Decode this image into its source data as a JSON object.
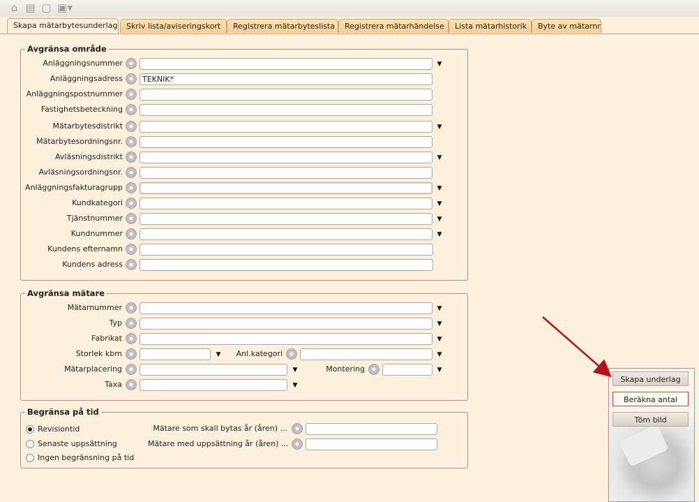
{
  "toolbar": {
    "icons": [
      "open-icon",
      "print-icon",
      "print-preview-icon",
      "export-menu-icon"
    ]
  },
  "tabs": [
    {
      "label": "Skapa mätarbytesunderlag",
      "active": true
    },
    {
      "label": "Skriv lista/aviseringskort",
      "active": false
    },
    {
      "label": "Registrera mätarbyteslista",
      "active": false
    },
    {
      "label": "Registrera mätarhändelse",
      "active": false
    },
    {
      "label": "Lista mätarhistorik",
      "active": false
    },
    {
      "label": "Byte av mätarnr",
      "active": false
    }
  ],
  "area": {
    "legend": "Avgränsa område",
    "fields": [
      {
        "label": "Anläggningsnummer",
        "value": "",
        "dropdown": true
      },
      {
        "label": "Anläggningsadress",
        "value": "TEKNIK*",
        "dropdown": false
      },
      {
        "label": "Anläggningspostnummer",
        "value": "",
        "dropdown": false
      },
      {
        "label": "Fastighetsbeteckning",
        "value": "",
        "dropdown": false
      },
      {
        "label": "Mätarbytesdistrikt",
        "value": "",
        "dropdown": true
      },
      {
        "label": "Mätarbytesordningsnr.",
        "value": "",
        "dropdown": false
      },
      {
        "label": "Avläsningsdistrikt",
        "value": "",
        "dropdown": true
      },
      {
        "label": "Avläsningsordningsnr.",
        "value": "",
        "dropdown": false
      },
      {
        "label": "Anläggningsfakturagrupp",
        "value": "",
        "dropdown": true
      },
      {
        "label": "Kundkategori",
        "value": "",
        "dropdown": true
      },
      {
        "label": "Tjänstnummer",
        "value": "",
        "dropdown": true
      },
      {
        "label": "Kundnummer",
        "value": "",
        "dropdown": true
      },
      {
        "label": "Kundens efternamn",
        "value": "",
        "dropdown": false
      },
      {
        "label": "Kundens adress",
        "value": "",
        "dropdown": false
      }
    ]
  },
  "meter": {
    "legend": "Avgränsa mätare",
    "matarnummer": {
      "label": "Mätarnummer",
      "value": ""
    },
    "typ": {
      "label": "Typ",
      "value": ""
    },
    "fabrikat": {
      "label": "Fabrikat",
      "value": ""
    },
    "storlek": {
      "label": "Storlek kbm",
      "value": ""
    },
    "anlkategori": {
      "label": "Anl.kategori",
      "value": ""
    },
    "matarplacering": {
      "label": "Mätarplacering",
      "value": ""
    },
    "montering": {
      "label": "Montering",
      "value": ""
    },
    "taxa": {
      "label": "Taxa",
      "value": ""
    }
  },
  "time": {
    "legend": "Begränsa på tid",
    "radios": [
      {
        "label": "Revisiontid",
        "checked": true
      },
      {
        "label": "Senaste uppsättning",
        "checked": false
      },
      {
        "label": "Ingen begränsning på tid",
        "checked": false
      }
    ],
    "replace_years": {
      "label": "Mätare som skall bytas år (åren) ...",
      "value": ""
    },
    "installed_years": {
      "label": "Mätare med uppsättning år (åren) ...",
      "value": ""
    }
  },
  "actions": {
    "create": "Skapa underlag",
    "count": "Beräkna antal",
    "clear": "Töm bild"
  },
  "colors": {
    "background": "#fdf0dc",
    "tab": "#f6cf8d",
    "group_border": "#b78f84",
    "highlight_border": "#c4424a",
    "arrow": "#b5121b"
  }
}
